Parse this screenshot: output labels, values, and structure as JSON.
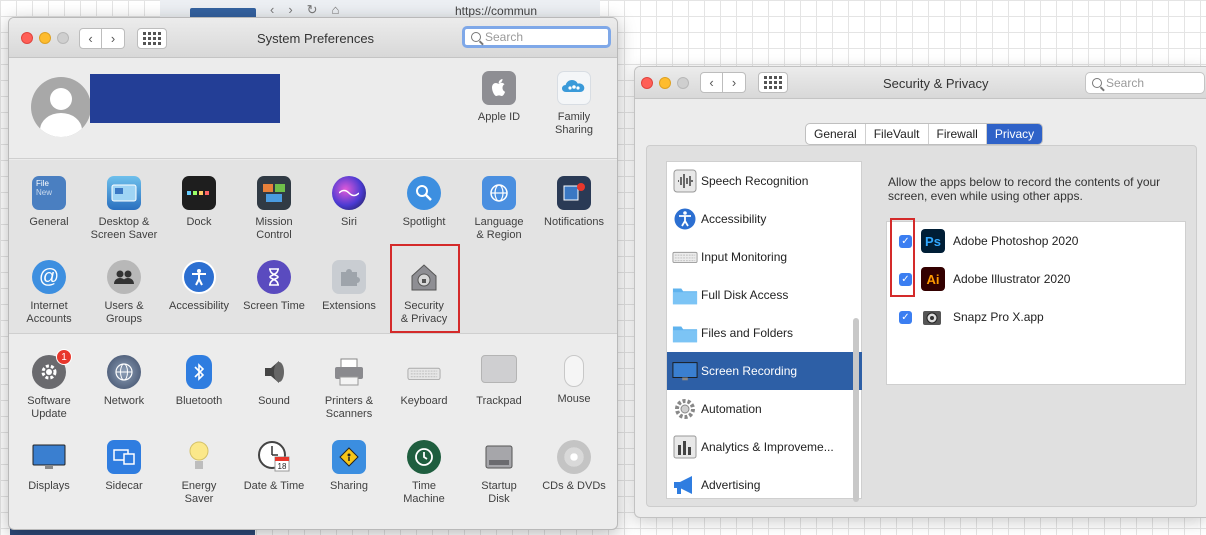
{
  "background": {
    "url_fragment": "https://commun"
  },
  "prefs_window": {
    "title": "System Preferences",
    "search_placeholder": "Search",
    "account_items": [
      {
        "label": "Apple ID"
      },
      {
        "label": "Family\nSharing"
      }
    ],
    "personal_items": [
      {
        "label": "General"
      },
      {
        "label": "Desktop &\nScreen Saver"
      },
      {
        "label": "Dock"
      },
      {
        "label": "Mission\nControl"
      },
      {
        "label": "Siri"
      },
      {
        "label": "Spotlight"
      },
      {
        "label": "Language\n& Region"
      },
      {
        "label": "Notifications"
      },
      {
        "label": "Internet\nAccounts"
      },
      {
        "label": "Users &\nGroups"
      },
      {
        "label": "Accessibility"
      },
      {
        "label": "Screen Time"
      },
      {
        "label": "Extensions"
      },
      {
        "label": "Security\n& Privacy"
      }
    ],
    "hardware_items": [
      {
        "label": "Software\nUpdate",
        "badge": "1"
      },
      {
        "label": "Network"
      },
      {
        "label": "Bluetooth"
      },
      {
        "label": "Sound"
      },
      {
        "label": "Printers &\nScanners"
      },
      {
        "label": "Keyboard"
      },
      {
        "label": "Trackpad"
      },
      {
        "label": "Mouse"
      },
      {
        "label": "Displays"
      },
      {
        "label": "Sidecar"
      },
      {
        "label": "Energy\nSaver"
      },
      {
        "label": "Date & Time"
      },
      {
        "label": "Sharing"
      },
      {
        "label": "Time\nMachine"
      },
      {
        "label": "Startup\nDisk"
      },
      {
        "label": "CDs & DVDs"
      }
    ],
    "icon_text": {
      "general_file": "File",
      "general_new": "New",
      "date_day": "18",
      "date_month": "JUL"
    }
  },
  "security_window": {
    "title": "Security & Privacy",
    "search_placeholder": "Search",
    "tabs": [
      "General",
      "FileVault",
      "Firewall",
      "Privacy"
    ],
    "active_tab": "Privacy",
    "privacy_list": [
      {
        "label": "Speech Recognition"
      },
      {
        "label": "Accessibility"
      },
      {
        "label": "Input Monitoring"
      },
      {
        "label": "Full Disk Access"
      },
      {
        "label": "Files and Folders"
      },
      {
        "label": "Screen Recording",
        "selected": true
      },
      {
        "label": "Automation"
      },
      {
        "label": "Analytics & Improveme..."
      },
      {
        "label": "Advertising"
      }
    ],
    "description": "Allow the apps below to record the contents of your screen, even while using other apps.",
    "apps": [
      {
        "label": "Adobe Photoshop 2020",
        "icon_text": "Ps",
        "checked": true
      },
      {
        "label": "Adobe Illustrator 2020",
        "icon_text": "Ai",
        "checked": true
      },
      {
        "label": "Snapz Pro X.app",
        "checked": true
      }
    ]
  }
}
